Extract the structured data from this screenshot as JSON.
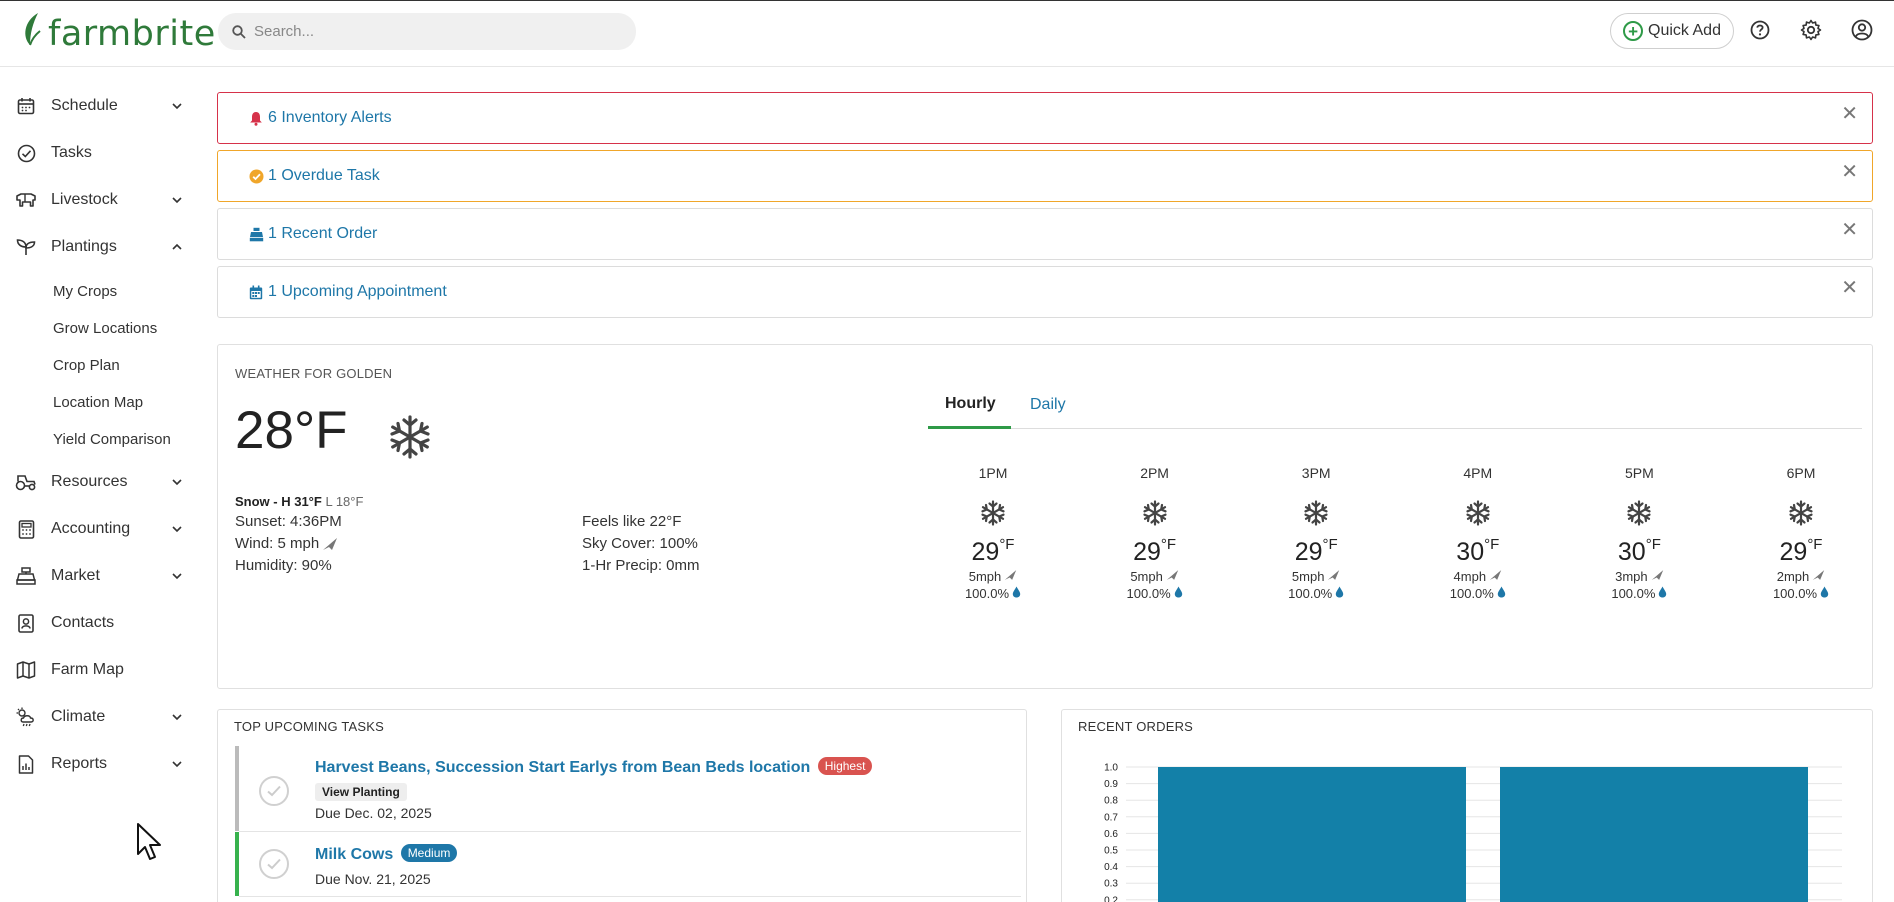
{
  "app": {
    "logo_text": "farmbrite",
    "brand_color": "#2f7a3a",
    "accent_color": "#1e77a8"
  },
  "header": {
    "search_placeholder": "Search...",
    "quick_add_label": "Quick Add",
    "icons": [
      "help-icon",
      "gear-icon",
      "user-account-icon"
    ]
  },
  "sidebar": {
    "items": [
      {
        "label": "Schedule",
        "icon": "calendar-icon",
        "expanded": false
      },
      {
        "label": "Tasks",
        "icon": "check-circle-icon"
      },
      {
        "label": "Livestock",
        "icon": "cow-icon",
        "expanded": false
      },
      {
        "label": "Plantings",
        "icon": "sprout-icon",
        "expanded": true
      },
      {
        "label": "Resources",
        "icon": "tractor-icon",
        "expanded": false
      },
      {
        "label": "Accounting",
        "icon": "calculator-icon",
        "expanded": false
      },
      {
        "label": "Market",
        "icon": "cash-register-icon",
        "expanded": false
      },
      {
        "label": "Contacts",
        "icon": "contact-card-icon"
      },
      {
        "label": "Farm Map",
        "icon": "map-icon"
      },
      {
        "label": "Climate",
        "icon": "cloud-sun-icon",
        "expanded": false
      },
      {
        "label": "Reports",
        "icon": "report-icon",
        "expanded": false
      }
    ],
    "plantings_sub": [
      "My Crops",
      "Grow Locations",
      "Crop Plan",
      "Location Map",
      "Yield Comparison"
    ]
  },
  "alerts": [
    {
      "label": "6 Inventory Alerts",
      "icon": "bell-icon",
      "color": "#d6324a"
    },
    {
      "label": "1 Overdue Task",
      "icon": "check-badge-icon",
      "color": "#f0a62a"
    },
    {
      "label": "1 Recent Order",
      "icon": "cash-register-icon",
      "color": "#dcdcdc"
    },
    {
      "label": "1 Upcoming Appointment",
      "icon": "calendar-icon",
      "color": "#dcdcdc"
    }
  ],
  "weather": {
    "title": "WEATHER FOR GOLDEN",
    "temp": "28°F",
    "condition": "Snow - H 31°F",
    "low": "L 18°F",
    "sunset": "Sunset: 4:36PM",
    "wind": "Wind: 5 mph",
    "humidity": "Humidity: 90%",
    "feels_like": "Feels like 22°F",
    "sky_cover": "Sky Cover: 100%",
    "precip": "1-Hr Precip: 0mm",
    "tabs": [
      "Hourly",
      "Daily"
    ],
    "active_tab": "Hourly",
    "hourly": [
      {
        "time": "1PM",
        "temp": "29",
        "wind": "5mph",
        "precip": "100.0%"
      },
      {
        "time": "2PM",
        "temp": "29",
        "wind": "5mph",
        "precip": "100.0%"
      },
      {
        "time": "3PM",
        "temp": "29",
        "wind": "5mph",
        "precip": "100.0%"
      },
      {
        "time": "4PM",
        "temp": "30",
        "wind": "4mph",
        "precip": "100.0%"
      },
      {
        "time": "5PM",
        "temp": "30",
        "wind": "3mph",
        "precip": "100.0%"
      },
      {
        "time": "6PM",
        "temp": "29",
        "wind": "2mph",
        "precip": "100.0%"
      }
    ],
    "unit": "°F"
  },
  "tasks": {
    "title": "TOP UPCOMING TASKS",
    "items": [
      {
        "title": "Harvest Beans, Succession Start Earlys from Bean Beds location",
        "priority": "Highest",
        "action": "View Planting",
        "due": "Due Dec. 02, 2025"
      },
      {
        "title": "Milk Cows",
        "priority": "Medium",
        "due": "Due Nov. 21, 2025"
      }
    ]
  },
  "orders": {
    "title": "RECENT ORDERS",
    "bar_color": "#1380a8"
  },
  "chart_data": {
    "type": "bar",
    "title": "",
    "categories": [
      "",
      ""
    ],
    "values": [
      1.0,
      1.0
    ],
    "yticks": [
      "1.0",
      "0.9",
      "0.8",
      "0.7",
      "0.6",
      "0.5",
      "0.4",
      "0.3",
      "0.2"
    ],
    "ylim": [
      0,
      1.0
    ],
    "grid": true
  }
}
